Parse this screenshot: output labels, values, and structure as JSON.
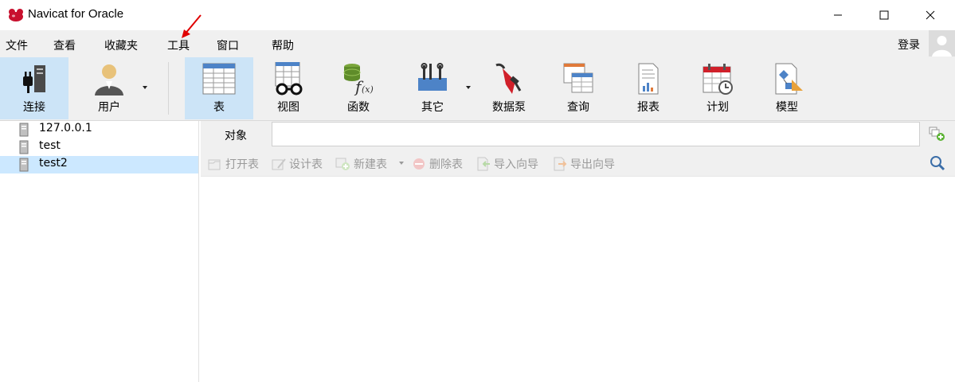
{
  "window": {
    "title": "Navicat for Oracle",
    "controls": {
      "minimize": "minimize",
      "maximize": "maximize",
      "close": "close"
    }
  },
  "menu": {
    "items": [
      "文件",
      "查看",
      "收藏夹",
      "工具",
      "窗口",
      "帮助"
    ],
    "login": "登录"
  },
  "toolbar": {
    "buttons": [
      {
        "label": "连接",
        "icon": "connect-plug-icon"
      },
      {
        "label": "用户",
        "icon": "user-icon"
      },
      {
        "label": "表",
        "icon": "table-icon"
      },
      {
        "label": "视图",
        "icon": "view-glasses-icon"
      },
      {
        "label": "函数",
        "icon": "function-icon"
      },
      {
        "label": "其它",
        "icon": "tools-icon"
      },
      {
        "label": "数据泵",
        "icon": "data-pump-icon"
      },
      {
        "label": "查询",
        "icon": "query-icon"
      },
      {
        "label": "报表",
        "icon": "report-icon"
      },
      {
        "label": "计划",
        "icon": "schedule-calendar-icon"
      },
      {
        "label": "模型",
        "icon": "model-icon"
      }
    ],
    "active": "表"
  },
  "tree": {
    "items": [
      {
        "label": "127.0.0.1"
      },
      {
        "label": "test"
      },
      {
        "label": "test2"
      }
    ],
    "selected": "test2"
  },
  "objects": {
    "label": "对象",
    "search_value": ""
  },
  "actions": {
    "open_table": "打开表",
    "design_table": "设计表",
    "new_table": "新建表",
    "delete_table": "删除表",
    "import_wizard": "导入向导",
    "export_wizard": "导出向导"
  },
  "colors": {
    "toolbar_bg": "#f0f0f0",
    "active_button": "#cce4f7",
    "selected_row": "#cce8ff",
    "annotation_arrow": "#e00000"
  }
}
